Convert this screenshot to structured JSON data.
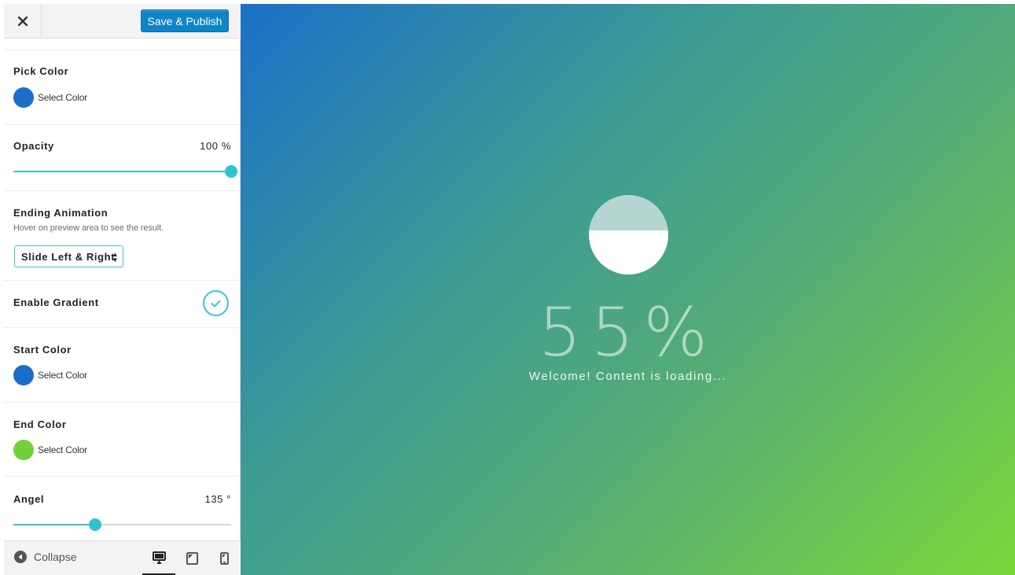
{
  "topbar": {
    "close_icon": "close-icon",
    "save_label": "Save & Publish"
  },
  "pick_color": {
    "title": "Pick Color",
    "swatch_color": "#1b6ec8",
    "label": "Select Color"
  },
  "opacity": {
    "title": "Opacity",
    "value_text": "100 %",
    "value": 100,
    "max": 100
  },
  "ending_animation": {
    "title": "Ending Animation",
    "hint": "Hover on preview area to see the result.",
    "selected": "Slide Left & Right"
  },
  "enable_gradient": {
    "title": "Enable Gradient",
    "checked": true
  },
  "start_color": {
    "title": "Start Color",
    "swatch_color": "#1b6ec8",
    "label": "Select Color"
  },
  "end_color": {
    "title": "End Color",
    "swatch_color": "#72d13b",
    "label": "Select Color"
  },
  "angle": {
    "title": "Angel",
    "value_text": "135 °",
    "value": 135,
    "max": 360
  },
  "footer": {
    "collapse_label": "Collapse",
    "devices": [
      "desktop-icon",
      "tablet-icon",
      "mobile-icon"
    ],
    "active_device": "desktop-icon"
  },
  "preview": {
    "percent_text": "55%",
    "progress": 0.55,
    "message": "Welcome! Content is loading...",
    "gradient_start": "#1b70c8",
    "gradient_end": "#7cd73a"
  }
}
